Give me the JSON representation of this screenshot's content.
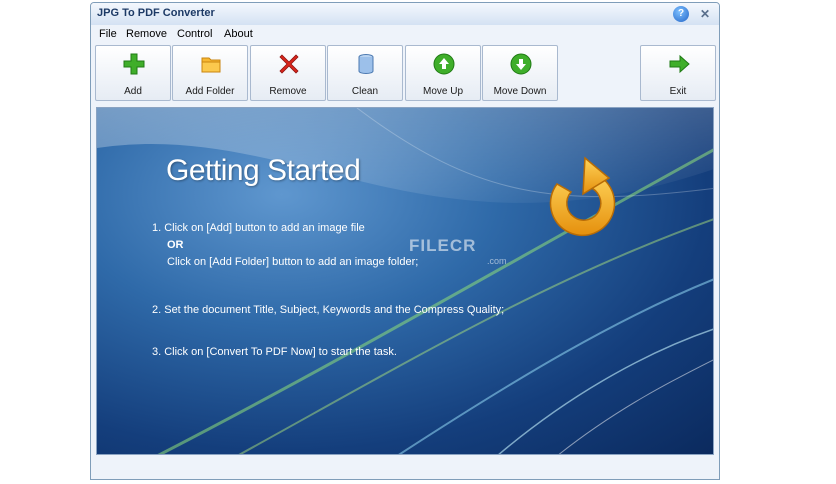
{
  "window": {
    "title": "JPG To PDF Converter",
    "help_symbol": "?",
    "close_symbol": "✕"
  },
  "menu": [
    "File",
    "Remove",
    "Control",
    "About"
  ],
  "toolbar": {
    "add": "Add",
    "add_folder": "Add Folder",
    "remove": "Remove",
    "clean": "Clean",
    "move_up": "Move Up",
    "move_down": "Move Down",
    "exit": "Exit"
  },
  "content": {
    "title": "Getting Started",
    "step1": "1. Click on [Add] button to add an image file",
    "or": "OR",
    "step1b": "Click on [Add Folder] button to add an image folder;",
    "step2": "2. Set the document Title, Subject, Keywords and the Compress Quality;",
    "step3": "3. Click on [Convert To PDF Now] to start the task.",
    "watermark": "FILECR",
    "watermark_suffix": ".com"
  },
  "colors": {
    "accent": "#2f6aa9",
    "green": "#3fae2a",
    "orange": "#f3a51b",
    "red": "#d9261c"
  }
}
